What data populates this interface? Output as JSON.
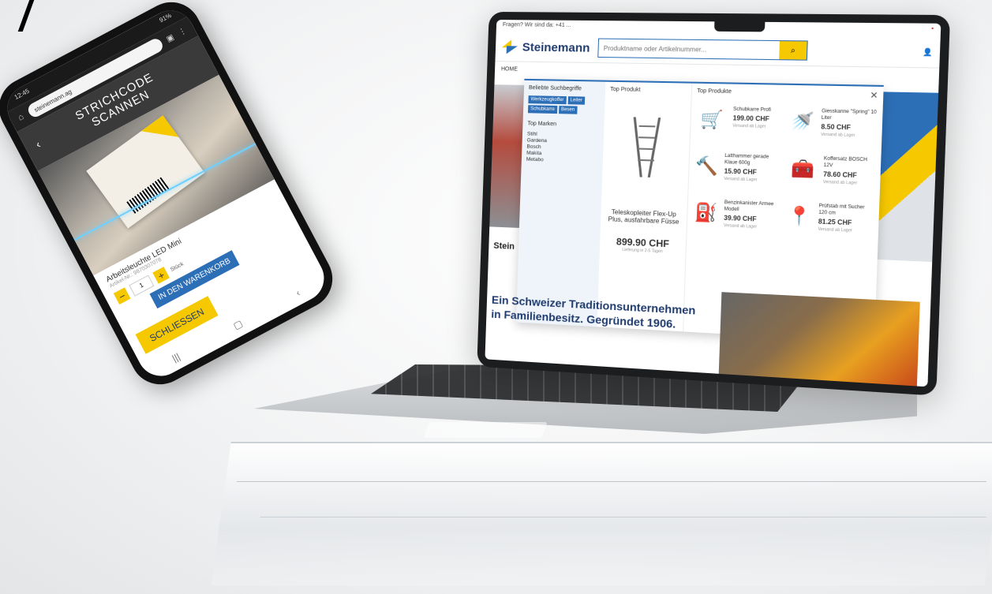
{
  "laptop": {
    "topbar_left": "Fragen? Wir sind da: +41 ...",
    "logo_text": "Steinemann",
    "search_placeholder": "Produktname oder Artikelnummer...",
    "nav_home": "HOME",
    "menu": {
      "col1_title": "Beliebte Suchbegriffe",
      "tags": [
        "Werkzeugkoffer",
        "Leiter",
        "Schubkarre",
        "Besen"
      ],
      "brands_title": "Top Marken",
      "brands": [
        "Stihl",
        "Gardena",
        "Bosch",
        "Makita",
        "Metabo"
      ],
      "col2_title": "Top Produkt",
      "featured_name": "Teleskopleiter Flex-Up Plus, ausfahrbare Füsse",
      "featured_price": "899.90 CHF",
      "featured_note": "Lieferung in 2-5 Tagen",
      "col3_title": "Top Produkte",
      "products": [
        {
          "icon": "wheelbarrow-icon",
          "glyph": "🛒",
          "name": "Schubkarre Profi",
          "price": "199.00 CHF",
          "note": "Versand ab Lager"
        },
        {
          "icon": "watering-can-icon",
          "glyph": "🚿",
          "name": "Giesskanne \"Spring\" 10 Liter",
          "price": "8.50 CHF",
          "note": "Versand ab Lager"
        },
        {
          "icon": "hammer-icon",
          "glyph": "🔨",
          "name": "Latthammer gerade Klaue 600g",
          "price": "15.90 CHF",
          "note": "Versand ab Lager"
        },
        {
          "icon": "toolbox-icon",
          "glyph": "🧰",
          "name": "Koffersatz BOSCH 12V",
          "price": "78.60 CHF",
          "note": "Versand ab Lager"
        },
        {
          "icon": "jerrycan-icon",
          "glyph": "⛽",
          "name": "Benzinkanister Armee Modell",
          "price": "39.90 CHF",
          "note": "Versand ab Lager"
        },
        {
          "icon": "probe-icon",
          "glyph": "📍",
          "name": "Prüfstab mit Sucher 120 cm",
          "price": "81.25 CHF",
          "note": "Versand ab Lager"
        }
      ]
    },
    "stein_label": "Stein",
    "tagline": "Ein Schweizer Traditionsunternehmen in Familienbesitz. Gegründet 1906."
  },
  "phone": {
    "status_left": "12:45",
    "status_right": "91%",
    "url": "steinemann.ag",
    "scan_title_line1": "STRICHCODE",
    "scan_title_line2": "SCANNEN",
    "product_title": "Arbeitsleuchte LED Mini",
    "article_label": "Artikel-Nr.: 9870307078",
    "quantity": "1",
    "unit": "Stück",
    "cart_button": "IN DEN WARENKORB",
    "close_button": "SCHLIESSEN"
  },
  "colors": {
    "brand_blue": "#2d6fb7",
    "brand_yellow": "#f6c800",
    "brand_navy": "#1f3b6e"
  }
}
